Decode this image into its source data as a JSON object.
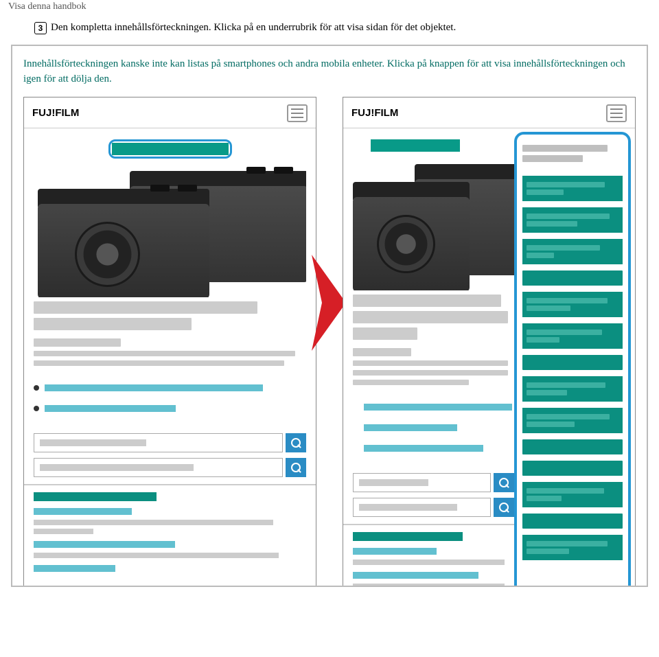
{
  "breadcrumb": "Visa denna handbok",
  "step": {
    "number": "3",
    "text": "Den kompletta innehållsförteckningen. Klicka på en underrubrik för att visa sidan för det objektet."
  },
  "illustration_text": "Innehållsförteckningen kanske inte kan listas på smartphones och andra mobila enheter. Klicka på knappen för att visa innehållsförteckningen och igen för att dölja den.",
  "logo": "FUJ!FILM",
  "colors": {
    "teal": "#0b8f80",
    "cyan": "#62c0d0",
    "highlight_blue": "#2596d4",
    "arrow_red": "#d61f26"
  }
}
